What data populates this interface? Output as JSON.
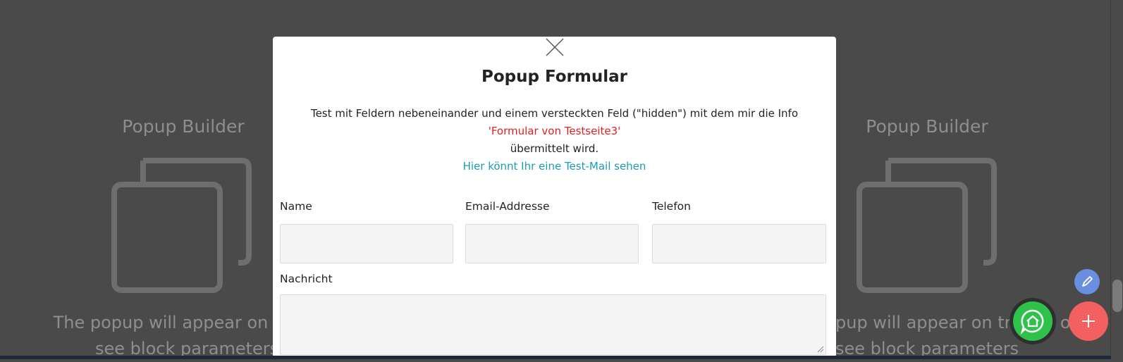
{
  "background": {
    "left_block": {
      "title": "Popup Builder",
      "text_line1": "The popup will appear on trigg",
      "text_line2": "see block parameters"
    },
    "right_block": {
      "title": "Popup Builder",
      "text_line1": "pup will appear on trigger only",
      "text_line2": "see block parameters"
    }
  },
  "modal": {
    "title": "Popup Formular",
    "description_line1": "Test mit Feldern nebeneinander und einem versteckten Feld (\"hidden\") mit dem mir die Info",
    "description_highlight": "'Formular von Testseite3'",
    "description_line3": "übermittelt wird.",
    "link_text": "Hier könnt Ihr eine Test-Mail sehen",
    "fields": {
      "name_label": "Name",
      "email_label": "Email-Addresse",
      "phone_label": "Telefon",
      "message_label": "Nachricht"
    }
  },
  "icons": {
    "close": "close-icon",
    "edit": "pencil-icon",
    "whatsapp": "whatsapp-icon",
    "add": "plus-icon"
  },
  "colors": {
    "overlay": "#4a4a4a",
    "highlight_red": "#e02020",
    "link_blue": "#1a9bb8",
    "edit_fab": "#6b8fe0",
    "whatsapp_green": "#2ec24a",
    "add_fab": "#f45f5f"
  }
}
